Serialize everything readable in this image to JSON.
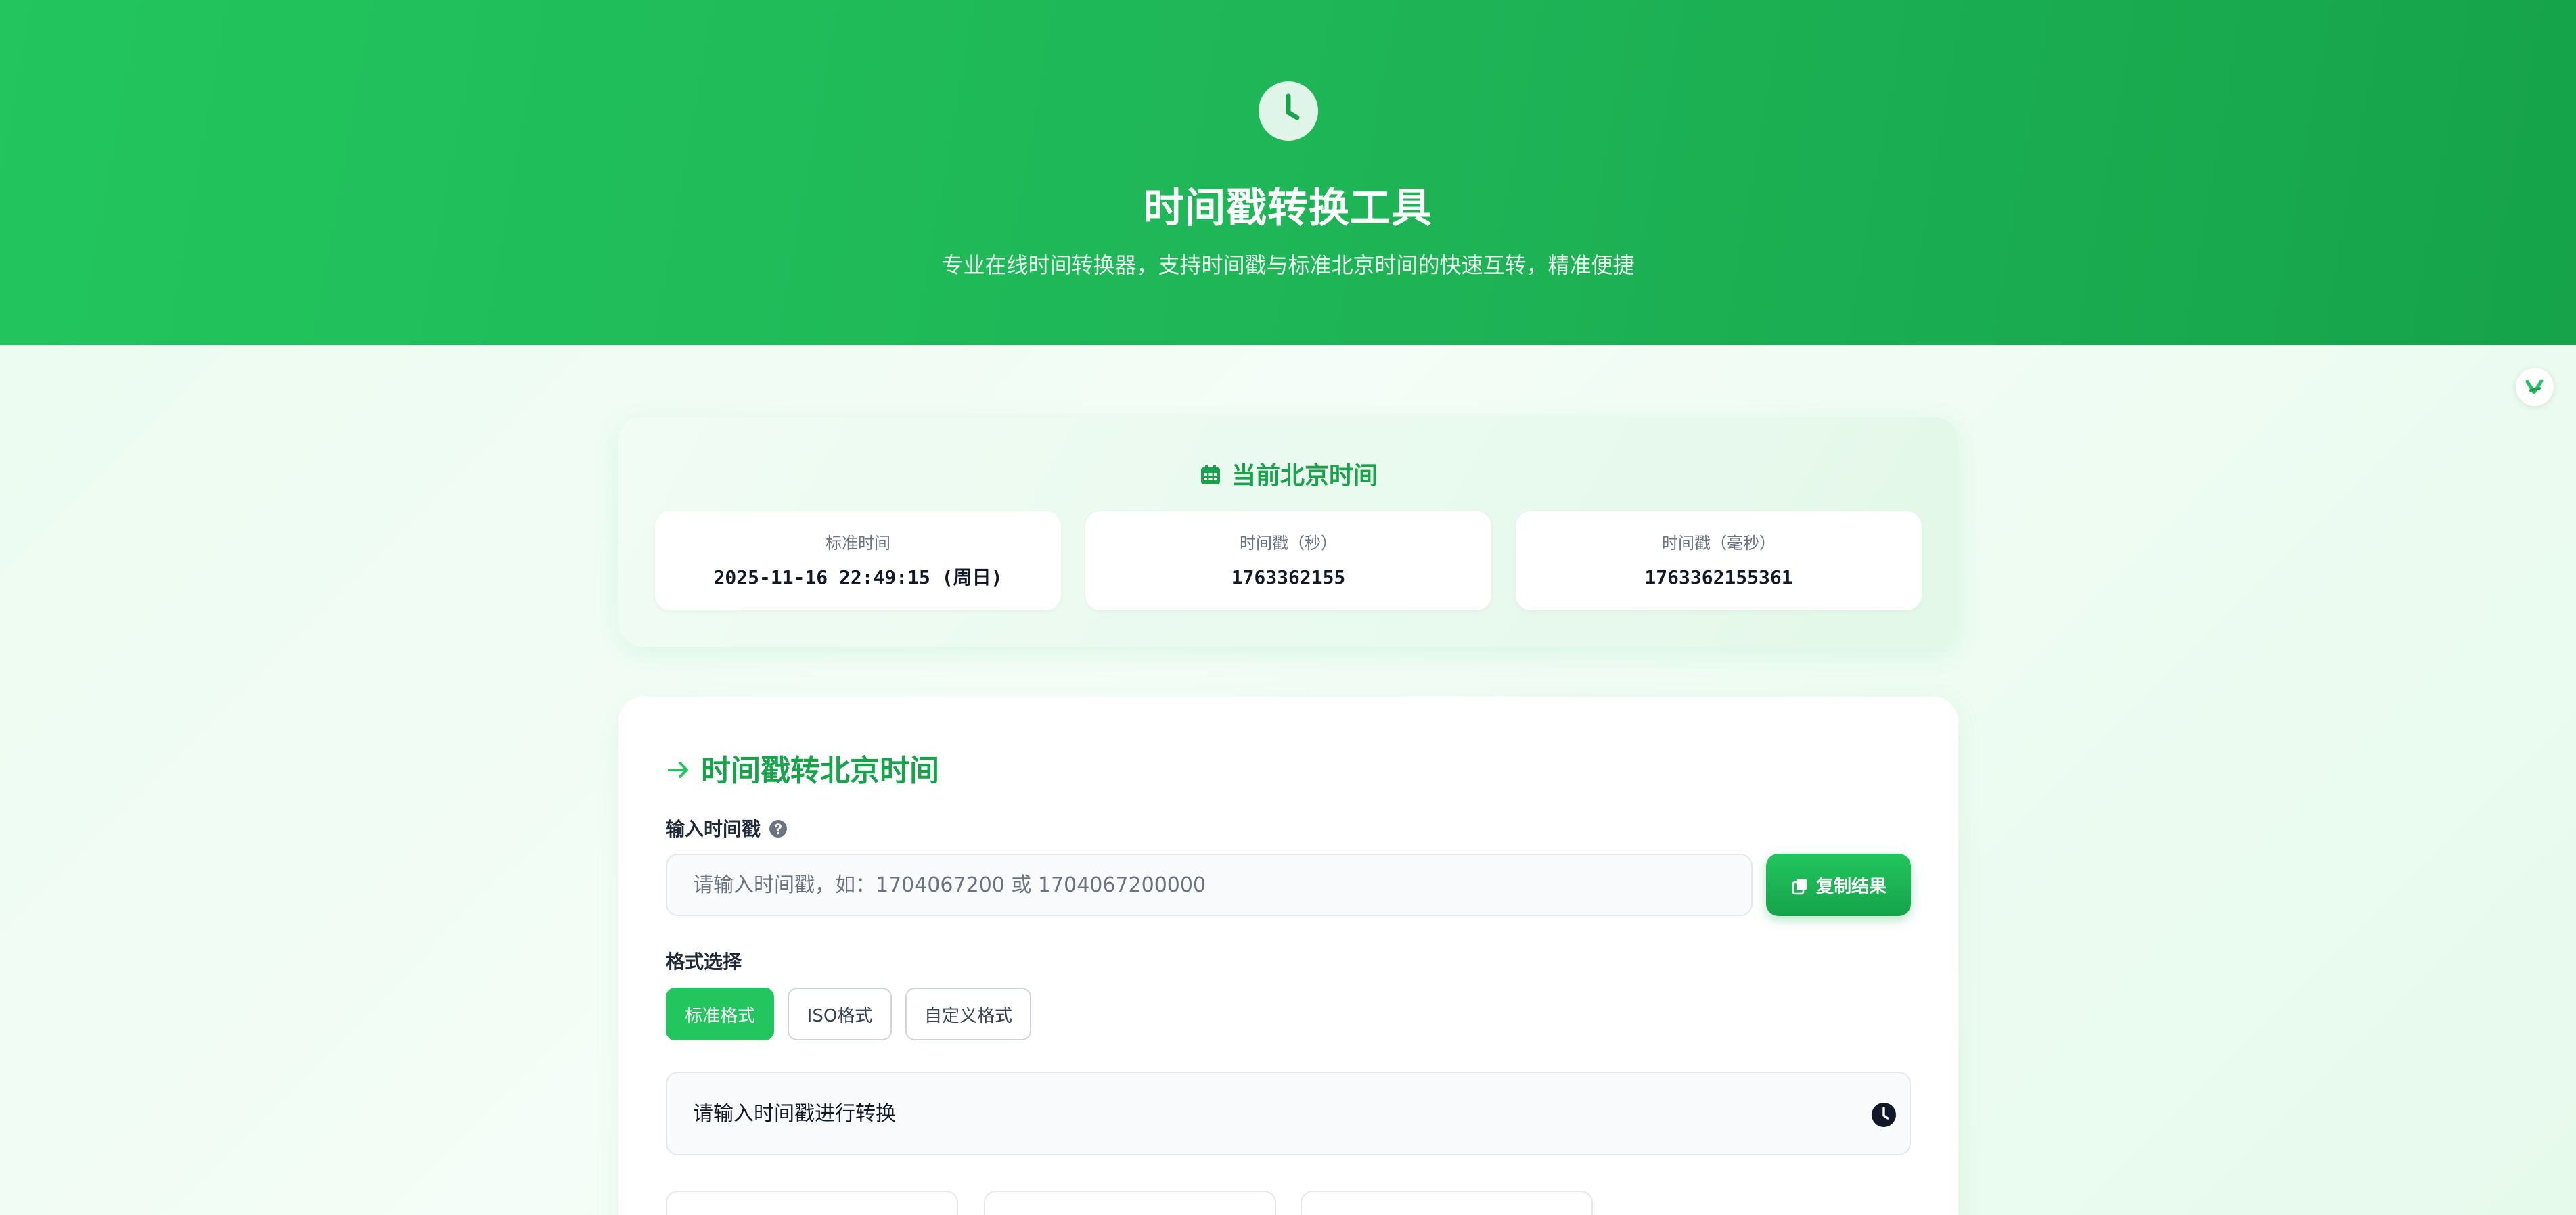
{
  "header": {
    "logo_icon": "clock-icon",
    "title": "时间戳转换工具",
    "subtitle": "专业在线时间转换器，支持时间戳与标准北京时间的快速互转，精准便捷"
  },
  "float_badge": {
    "icon": "yun-logo-icon"
  },
  "current_time": {
    "icon": "calendar-icon",
    "title": "当前北京时间",
    "tiles": [
      {
        "label": "标准时间",
        "value": "2025-11-16 22:49:15 (周日)"
      },
      {
        "label": "时间戳（秒）",
        "value": "1763362155"
      },
      {
        "label": "时间戳（毫秒）",
        "value": "1763362155361"
      }
    ]
  },
  "converter": {
    "icon": "arrow-right-icon",
    "title": "时间戳转北京时间",
    "input_label": "输入时间戳",
    "input_help_icon": "question-circle-icon",
    "input_value": "",
    "input_placeholder": "请输入时间戳，如：1704067200 或 1704067200000",
    "copy_button": {
      "icon": "copy-icon",
      "label": "复制结果"
    },
    "format_label": "格式选择",
    "formats": [
      {
        "label": "标准格式",
        "active": true
      },
      {
        "label": "ISO格式",
        "active": false
      },
      {
        "label": "自定义格式",
        "active": false
      }
    ],
    "result_text": "请输入时间戳进行转换",
    "result_icon": "clock-icon"
  },
  "colors": {
    "primary": "#22c55e",
    "primary_dark": "#16a34a",
    "text_dark": "#111827",
    "text_muted": "#6b7280",
    "border": "#e5e7eb"
  }
}
